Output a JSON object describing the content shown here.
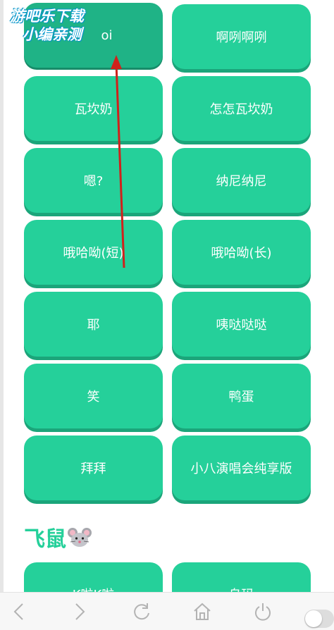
{
  "watermark": {
    "line1": "游吧乐下载",
    "line2": "小编亲测"
  },
  "buttons": [
    {
      "label": "oi"
    },
    {
      "label": "啊咧啊咧"
    },
    {
      "label": "瓦坎奶"
    },
    {
      "label": "怎怎瓦坎奶"
    },
    {
      "label": "嗯?"
    },
    {
      "label": "纳尼纳尼"
    },
    {
      "label": "哦哈呦(短)"
    },
    {
      "label": "哦哈呦(长)"
    },
    {
      "label": "耶"
    },
    {
      "label": "咦哒哒哒"
    },
    {
      "label": "笑"
    },
    {
      "label": "鸭蛋"
    },
    {
      "label": "拜拜"
    },
    {
      "label": "小八演唱会纯享版"
    }
  ],
  "section": {
    "title": "飞鼠",
    "icon": "mouse-face-icon"
  },
  "next_buttons": [
    {
      "label": "K啦K啦"
    },
    {
      "label": "乌玛"
    }
  ],
  "colors": {
    "accent": "#25d09a",
    "accent_shadow": "#1ba57a",
    "annotation_arrow": "#d0211b"
  },
  "bottom_nav": {
    "icons": [
      "back-icon",
      "forward-icon",
      "refresh-icon",
      "home-icon",
      "power-icon",
      "toggle-switch"
    ]
  }
}
